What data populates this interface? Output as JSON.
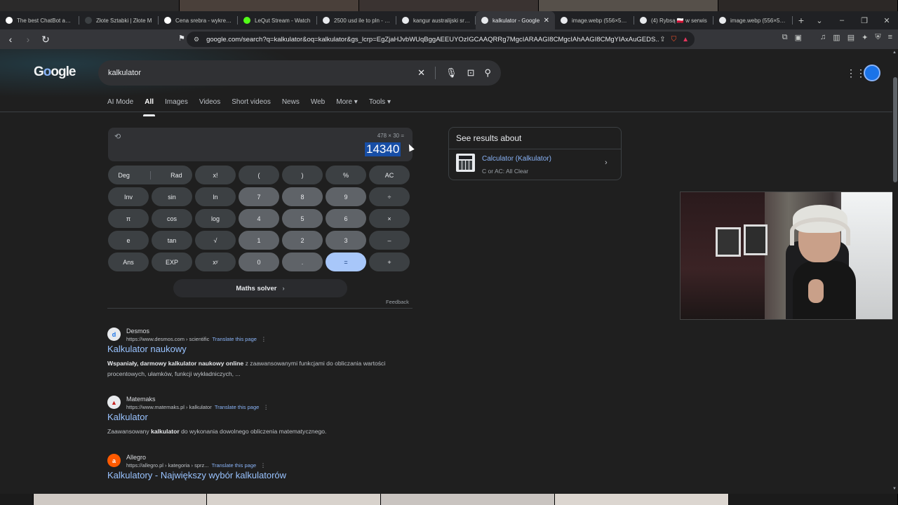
{
  "browser": {
    "tabs": [
      {
        "label": "The best ChatBot and W",
        "icon": "chatbot-icon",
        "color": "#ffffff"
      },
      {
        "label": "Złote Sztabki | Złote M",
        "icon": "gold-icon",
        "color": "#3c4043"
      },
      {
        "label": "Cena srebra - wykres, c",
        "icon": "chart-icon",
        "color": "#ffffff"
      },
      {
        "label": "LeQut Stream - Watch",
        "icon": "kick-icon",
        "color": "#53fc18"
      },
      {
        "label": "2500 usd ile to pln - Go",
        "icon": "google-icon",
        "color": "#e8eaed"
      },
      {
        "label": "kangur australijski sreb",
        "icon": "google-icon",
        "color": "#e8eaed"
      },
      {
        "label": "kalkulator - Google",
        "icon": "google-icon",
        "color": "#e8eaed"
      },
      {
        "label": "image.webp (556×574)",
        "icon": "globe-icon",
        "color": "#e8eaed"
      },
      {
        "label": "(4) Rybsą 🇵🇱 w serwis",
        "icon": "x-icon",
        "color": "#e8eaed"
      },
      {
        "label": "image.webp (556×574)",
        "icon": "globe-icon",
        "color": "#e8eaed"
      }
    ],
    "active_tab_index": 6,
    "new_tab": "+",
    "url": "google.com/search?q=kalkulator&oq=kalkulator&gs_lcrp=EgZjaHJvbWUqBggAEEUYOzIGCAAQRRg7MgcIARAAGI8CMgcIAhAAGI8CMgYIAxAuGEDS..."
  },
  "google": {
    "logo": "Google",
    "query": "kalkulator",
    "nav_tabs": [
      "AI Mode",
      "All",
      "Images",
      "Videos",
      "Short videos",
      "News",
      "Web",
      "More ▾",
      "Tools ▾"
    ],
    "selected_nav": "All"
  },
  "calculator": {
    "expression": "478 × 30 =",
    "result": "14340",
    "keys": [
      [
        "Deg",
        "Rad",
        "x!",
        "(",
        ")",
        "%",
        "AC"
      ],
      [
        "Inv",
        "sin",
        "ln",
        "7",
        "8",
        "9",
        "÷"
      ],
      [
        "π",
        "cos",
        "log",
        "4",
        "5",
        "6",
        "×"
      ],
      [
        "e",
        "tan",
        "√",
        "1",
        "2",
        "3",
        "–"
      ],
      [
        "Ans",
        "EXP",
        "xʸ",
        "0",
        ".",
        "=",
        "+"
      ]
    ],
    "maths_solver": "Maths solver",
    "feedback": "Feedback"
  },
  "see_results": {
    "title": "See results about",
    "item_title": "Calculator (Kalkulator)",
    "item_subtitle": "C or AC: All Clear"
  },
  "results": [
    {
      "site": "Desmos",
      "url": "https://www.desmos.com › scientific",
      "translate": "Translate this page",
      "title": "Kalkulator naukowy",
      "snippet_bold": "Wspaniały, darmowy kalkulator naukowy online",
      "snippet_rest": " z zaawansowanymi funkcjami do obliczania wartości procentowych, ułamków, funkcji wykładniczych, ...",
      "favicon": "d"
    },
    {
      "site": "Matemaks",
      "url": "https://www.matemaks.pl › kalkulator",
      "translate": "Translate this page",
      "title": "Kalkulator",
      "snippet_pre": "Zaawansowany ",
      "snippet_bold": "kalkulator",
      "snippet_rest": " do wykonania dowolnego obliczenia matematycznego.",
      "favicon": "▲"
    },
    {
      "site": "Allegro",
      "url": "https://allegro.pl › kategoria › sprz...",
      "translate": "Translate this page",
      "title": "Kalkulatory - Największy wybór kalkulatorów",
      "favicon": "a"
    }
  ]
}
